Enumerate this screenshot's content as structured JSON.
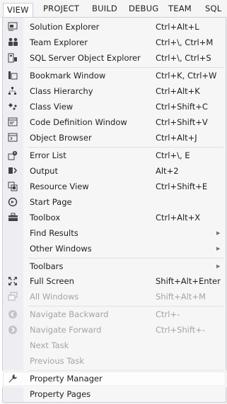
{
  "menubar": {
    "items": [
      {
        "label": "VIEW",
        "active": true
      },
      {
        "label": "PROJECT"
      },
      {
        "label": "BUILD"
      },
      {
        "label": "DEBUG"
      },
      {
        "label": "TEAM"
      },
      {
        "label": "SQL"
      }
    ]
  },
  "menu": {
    "items": [
      {
        "label": "Solution Explorer",
        "shortcut": "Ctrl+Alt+L",
        "icon": "solution-explorer-icon"
      },
      {
        "label": "Team Explorer",
        "shortcut": "Ctrl+\\, Ctrl+M",
        "icon": "team-explorer-icon"
      },
      {
        "label": "SQL Server Object Explorer",
        "shortcut": "Ctrl+\\, Ctrl+S",
        "icon": "sql-server-object-explorer-icon"
      },
      {
        "label": "Bookmark Window",
        "shortcut": "Ctrl+K, Ctrl+W",
        "icon": "bookmark-window-icon"
      },
      {
        "label": "Class Hierarchy",
        "shortcut": "Ctrl+Alt+K",
        "icon": "class-hierarchy-icon"
      },
      {
        "label": "Class View",
        "shortcut": "Ctrl+Shift+C",
        "icon": "class-view-icon"
      },
      {
        "label": "Code Definition Window",
        "shortcut": "Ctrl+Shift+V",
        "icon": "code-definition-window-icon"
      },
      {
        "label": "Object Browser",
        "shortcut": "Ctrl+Alt+J",
        "icon": "object-browser-icon"
      },
      {
        "label": "Error List",
        "shortcut": "Ctrl+\\, E",
        "icon": "error-list-icon"
      },
      {
        "label": "Output",
        "shortcut": "Alt+2",
        "icon": "output-icon"
      },
      {
        "label": "Resource View",
        "shortcut": "Ctrl+Shift+E",
        "icon": "resource-view-icon"
      },
      {
        "label": "Start Page",
        "shortcut": "",
        "icon": "start-page-icon"
      },
      {
        "label": "Toolbox",
        "shortcut": "Ctrl+Alt+X",
        "icon": "toolbox-icon"
      },
      {
        "label": "Find Results",
        "shortcut": "",
        "submenu": true
      },
      {
        "label": "Other Windows",
        "shortcut": "",
        "submenu": true
      },
      {
        "label": "Toolbars",
        "shortcut": "",
        "submenu": true
      },
      {
        "label": "Full Screen",
        "shortcut": "Shift+Alt+Enter",
        "icon": "full-screen-icon"
      },
      {
        "label": "All Windows",
        "shortcut": "Shift+Alt+M",
        "icon": "all-windows-icon",
        "disabled": true
      },
      {
        "label": "Navigate Backward",
        "shortcut": "Ctrl+-",
        "icon": "navigate-backward-icon",
        "disabled": true
      },
      {
        "label": "Navigate Forward",
        "shortcut": "Ctrl+Shift+-",
        "icon": "navigate-forward-icon",
        "disabled": true
      },
      {
        "label": "Next Task",
        "shortcut": "",
        "disabled": true
      },
      {
        "label": "Previous Task",
        "shortcut": "",
        "disabled": true
      },
      {
        "label": "Property Manager",
        "shortcut": "",
        "icon": "wrench-icon",
        "highlighted": true
      },
      {
        "label": "Property Pages",
        "shortcut": ""
      }
    ]
  },
  "colors": {
    "menubar_bg": "#f5f5f5",
    "menu_bg": "#f6f6f6",
    "gutter_bg": "#eeeef2",
    "text": "#1e1e1e",
    "disabled_text": "#a2a4a5",
    "border": "#cccedb"
  }
}
